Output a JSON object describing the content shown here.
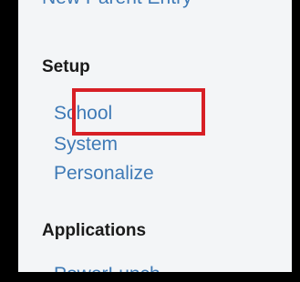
{
  "sidebar": {
    "clipped_top_link": "New Parent Entry",
    "sections": [
      {
        "title": "Setup",
        "items": [
          {
            "label": "School"
          },
          {
            "label": "System"
          },
          {
            "label": "Personalize"
          }
        ]
      },
      {
        "title": "Applications",
        "items": [
          {
            "label": "PowerLunch"
          }
        ]
      }
    ]
  },
  "colors": {
    "link": "#3f7ab6",
    "heading": "#1a1a1a",
    "highlight": "#d71f25",
    "background": "#f3f5f7"
  }
}
